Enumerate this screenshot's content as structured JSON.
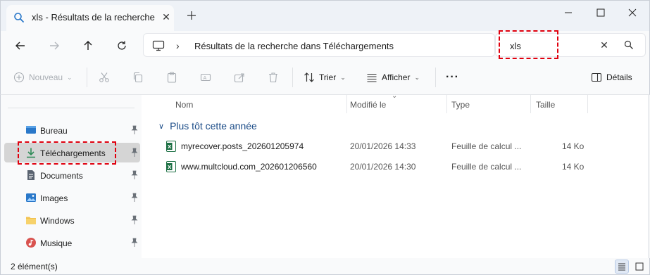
{
  "window": {
    "tab_title": "xls - Résultats de la recherche",
    "new_tab_icon": "plus-icon",
    "controls": [
      "minimize-icon",
      "maximize-icon",
      "close-icon"
    ]
  },
  "nav": {
    "address_path": "Résultats de la recherche dans Téléchargements",
    "search_query": "xls"
  },
  "toolbar": {
    "new_label": "Nouveau",
    "sort_label": "Trier",
    "view_label": "Afficher",
    "more_label": "···",
    "details_label": "Détails"
  },
  "sidebar": {
    "items": [
      {
        "label": "Bureau",
        "icon": "desktop-icon",
        "color": "#2a78c9"
      },
      {
        "label": "Téléchargements",
        "icon": "download-icon",
        "color": "#2e8b57"
      },
      {
        "label": "Documents",
        "icon": "documents-icon",
        "color": "#5a6370"
      },
      {
        "label": "Images",
        "icon": "images-icon",
        "color": "#2a78c9"
      },
      {
        "label": "Windows",
        "icon": "folder-icon",
        "color": "#f2c14e"
      },
      {
        "label": "Musique",
        "icon": "music-icon",
        "color": "#d9534f"
      }
    ]
  },
  "table": {
    "headers": {
      "name": "Nom",
      "modified": "Modifié le",
      "type": "Type",
      "size": "Taille"
    },
    "group_label": "Plus tôt cette année",
    "rows": [
      {
        "name": "myrecover.posts_202601205974",
        "modified": "20/01/2026 14:33",
        "type": "Feuille de calcul ...",
        "size": "14 Ko"
      },
      {
        "name": "www.multcloud.com_202601206560",
        "modified": "20/01/2026 14:30",
        "type": "Feuille de calcul ...",
        "size": "14 Ko"
      }
    ]
  },
  "status": {
    "count": "2 élément(s)"
  },
  "colors": {
    "highlight": "#e0000e",
    "accent": "#1a4b87",
    "excel": "#1d7044"
  }
}
